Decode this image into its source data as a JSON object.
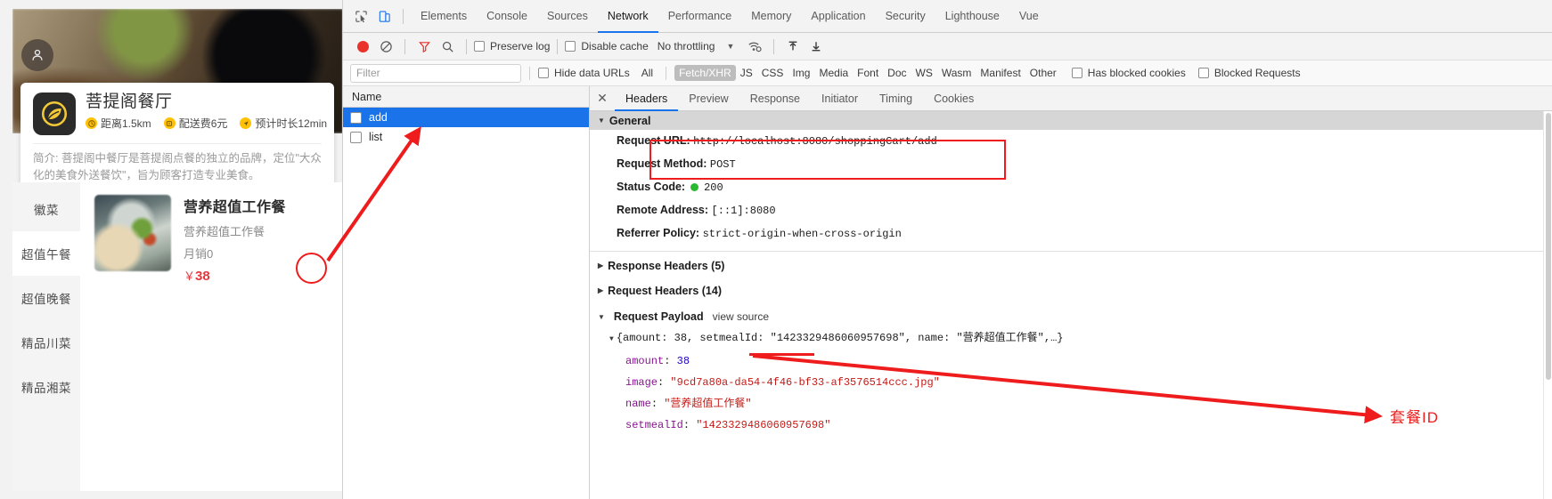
{
  "app": {
    "avatar_icon": "user-icon",
    "shop": {
      "name": "菩提阁餐厅",
      "logo_icon": "leaf-logo-icon",
      "stats": [
        {
          "icon": "clock-icon",
          "text": "距离1.5km"
        },
        {
          "icon": "money-icon",
          "text": "配送费6元"
        },
        {
          "icon": "navigate-icon",
          "text": "预计时长12min"
        }
      ],
      "description": "简介: 菩提阁中餐厅是菩提阁点餐的独立的品牌，定位\"大众化的美食外送餐饮\"，旨为顾客打造专业美食。"
    },
    "categories": [
      {
        "label": "徽菜",
        "active": false
      },
      {
        "label": "超值午餐",
        "active": true
      },
      {
        "label": "超值晚餐",
        "active": false
      },
      {
        "label": "精品川菜",
        "active": false
      },
      {
        "label": "精品湘菜",
        "active": false
      }
    ],
    "dish": {
      "title": "营养超值工作餐",
      "subtitle": "营养超值工作餐",
      "sold": "月销0",
      "currency": "￥",
      "price": "38",
      "add_label": "+"
    }
  },
  "devtools": {
    "left_icons": [
      "inspect-element-icon",
      "device-toolbar-icon"
    ],
    "tabs": [
      {
        "label": "Elements",
        "active": false
      },
      {
        "label": "Console",
        "active": false
      },
      {
        "label": "Sources",
        "active": false
      },
      {
        "label": "Network",
        "active": true
      },
      {
        "label": "Performance",
        "active": false
      },
      {
        "label": "Memory",
        "active": false
      },
      {
        "label": "Application",
        "active": false
      },
      {
        "label": "Security",
        "active": false
      },
      {
        "label": "Lighthouse",
        "active": false
      },
      {
        "label": "Vue",
        "active": false
      }
    ],
    "toolbar": {
      "record_icon": "record-stop-icon",
      "clear_icon": "clear-icon",
      "filter_icon": "filter-funnel-icon",
      "search_icon": "search-icon",
      "preserve_log": "Preserve log",
      "disable_cache": "Disable cache",
      "throttling": "No throttling",
      "throttle_caret": "▼",
      "wifi_icon": "network-conditions-icon",
      "import_icon": "import-har-icon",
      "export_icon": "export-har-icon"
    },
    "filterbar": {
      "filter_placeholder": "Filter",
      "filter_value": "",
      "hide_data_urls": "Hide data URLs",
      "types": [
        {
          "label": "All",
          "active": false
        },
        {
          "label": "Fetch/XHR",
          "active": true
        },
        {
          "label": "JS",
          "active": false
        },
        {
          "label": "CSS",
          "active": false
        },
        {
          "label": "Img",
          "active": false
        },
        {
          "label": "Media",
          "active": false
        },
        {
          "label": "Font",
          "active": false
        },
        {
          "label": "Doc",
          "active": false
        },
        {
          "label": "WS",
          "active": false
        },
        {
          "label": "Wasm",
          "active": false
        },
        {
          "label": "Manifest",
          "active": false
        },
        {
          "label": "Other",
          "active": false
        }
      ],
      "has_blocked_cookies": "Has blocked cookies",
      "blocked_requests": "Blocked Requests"
    },
    "requests": {
      "column_header": "Name",
      "rows": [
        {
          "name": "add",
          "selected": true
        },
        {
          "name": "list",
          "selected": false
        }
      ]
    },
    "detail": {
      "close_icon": "close-icon",
      "tabs": [
        {
          "label": "Headers",
          "active": true
        },
        {
          "label": "Preview",
          "active": false
        },
        {
          "label": "Response",
          "active": false
        },
        {
          "label": "Initiator",
          "active": false
        },
        {
          "label": "Timing",
          "active": false
        },
        {
          "label": "Cookies",
          "active": false
        }
      ],
      "general": {
        "title": "General",
        "rows": [
          {
            "key": "Request URL:",
            "value": "http://localhost:8080/shoppingCart/add"
          },
          {
            "key": "Request Method:",
            "value": "POST"
          },
          {
            "key": "Status Code:",
            "value": "200",
            "status_dot": "#2ab930"
          },
          {
            "key": "Remote Address:",
            "value": "[::1]:8080"
          },
          {
            "key": "Referrer Policy:",
            "value": "strict-origin-when-cross-origin"
          }
        ]
      },
      "response_headers": "Response Headers (5)",
      "request_headers": "Request Headers (14)",
      "payload": {
        "title": "Request Payload",
        "view_source": "view source",
        "summary_parts": [
          {
            "text": "{",
            "cls": "c-plain"
          },
          {
            "text": "amount",
            "cls": "c-plain"
          },
          {
            "text": ": ",
            "cls": "c-plain"
          },
          {
            "text": "38",
            "cls": "c-plain"
          },
          {
            "text": ", setmealId: ",
            "cls": "c-plain"
          },
          {
            "text": "\"1423329486060957698\"",
            "cls": "c-plain"
          },
          {
            "text": ", name: ",
            "cls": "c-plain"
          },
          {
            "text": "\"营养超值工作餐\"",
            "cls": "c-plain"
          },
          {
            "text": ",…}",
            "cls": "c-plain"
          }
        ],
        "summary_text": "{amount: 38, setmealId: \"1423329486060957698\", name: \"营养超值工作餐\",…}",
        "fields": [
          {
            "key": "amount",
            "value": "38",
            "type": "number"
          },
          {
            "key": "image",
            "value": "\"9cd7a80a-da54-4f46-bf33-af3576514ccc.jpg\"",
            "type": "string"
          },
          {
            "key": "name",
            "value": "\"营养超值工作餐\"",
            "type": "string"
          },
          {
            "key": "setmealId",
            "value": "\"1423329486060957698\"",
            "type": "string"
          }
        ]
      }
    }
  },
  "annotations": {
    "color": "#ee1c1c",
    "setmeal_id_label": "套餐ID"
  }
}
